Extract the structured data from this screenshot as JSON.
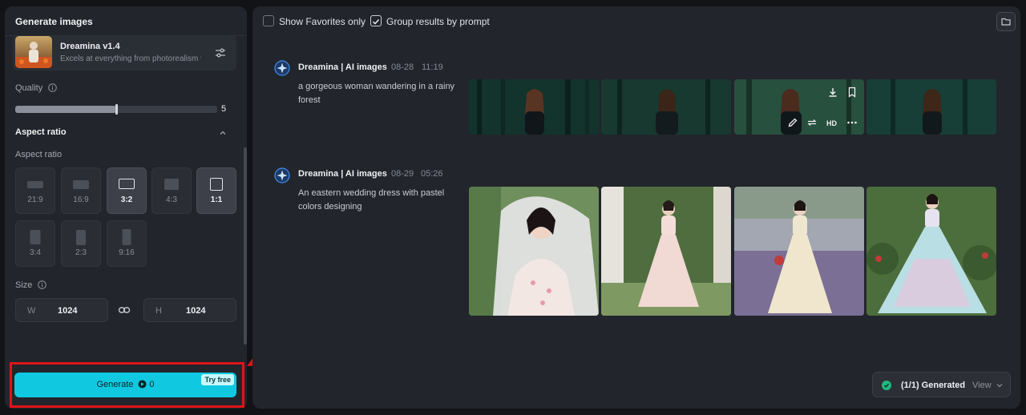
{
  "left_panel": {
    "title": "Generate images",
    "model": {
      "name": "Dreamina v1.4",
      "description": "Excels at everything from photorealism to painterly"
    },
    "quality": {
      "label": "Quality",
      "value": "5",
      "level_fraction": 0.5
    },
    "aspect_section_title": "Aspect ratio",
    "aspect_label": "Aspect ratio",
    "ratios": [
      {
        "label": "21:9",
        "selected": false
      },
      {
        "label": "16:9",
        "selected": false
      },
      {
        "label": "3:2",
        "selected": true
      },
      {
        "label": "4:3",
        "selected": false
      },
      {
        "label": "1:1",
        "selected": true
      },
      {
        "label": "3:4",
        "selected": false
      },
      {
        "label": "2:3",
        "selected": false
      },
      {
        "label": "9:16",
        "selected": false
      }
    ],
    "size": {
      "label": "Size",
      "w_prefix": "W",
      "w_value": "1024",
      "h_prefix": "H",
      "h_value": "1024"
    },
    "generate": {
      "label": "Generate",
      "credits": "0",
      "badge": "Try free"
    }
  },
  "right_panel": {
    "filters": {
      "favorites_label": "Show Favorites only",
      "favorites_checked": false,
      "group_label": "Group results by prompt",
      "group_checked": true
    },
    "results": [
      {
        "author": "Dreamina | AI images",
        "date": "08-28",
        "time": "11:19",
        "prompt": "a gorgeous woman wandering in a rainy forest"
      },
      {
        "author": "Dreamina | AI images",
        "date": "08-29",
        "time": "05:26",
        "prompt": "An eastern wedding dress with pastel colors designing"
      }
    ],
    "hover_tools": {
      "hd_label": "HD"
    },
    "status": {
      "text": "(1/1) Generated",
      "view_label": "View"
    }
  },
  "colors": {
    "accent": "#10c9e0",
    "annotation_red": "#e0131a",
    "panel_bg": "#22252c",
    "success": "#1fb981"
  },
  "icons": [
    "sliders-icon",
    "info-icon",
    "chevron-up-icon",
    "link-icon",
    "coin-icon",
    "folder-icon",
    "download-icon",
    "bookmark-icon",
    "edit-icon",
    "remix-icon",
    "more-icon",
    "check-circle-icon",
    "chevron-down-icon",
    "dreamina-logo-icon"
  ]
}
